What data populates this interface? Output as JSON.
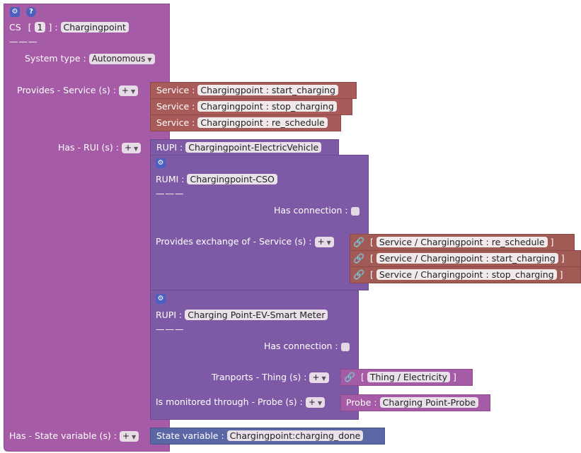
{
  "cs": {
    "prefix": "CS",
    "lb": "[",
    "index": "1",
    "rb": "] :",
    "name": "Chargingpoint",
    "separator": "———",
    "system_type_label": "System type :",
    "system_type_value": "Autonomous",
    "provides_label": "Provides - Service (s) :",
    "has_rui_label": "Has - RUI (s) :",
    "has_state_label": "Has - State variable (s) :",
    "plus": "+"
  },
  "services": [
    {
      "label": "Service :",
      "value": "Chargingpoint : start_charging"
    },
    {
      "label": "Service :",
      "value": "Chargingpoint : stop_charging"
    },
    {
      "label": "Service :",
      "value": "Chargingpoint : re_schedule"
    }
  ],
  "rupi1": {
    "label": "RUPI :",
    "value": "Chargingpoint-ElectricVehicle"
  },
  "rumi": {
    "label": "RUMI :",
    "value": "Chargingpoint-CSO",
    "separator": "———",
    "has_connection_label": "Has connection :",
    "exchange_label": "Provides exchange of - Service (s) :",
    "plus": "+"
  },
  "exchanges": [
    {
      "lb": "[",
      "value": "Service / Chargingpoint : re_schedule",
      "rb": "]"
    },
    {
      "lb": "[",
      "value": "Service / Chargingpoint : start_charging",
      "rb": "]"
    },
    {
      "lb": "[",
      "value": "Service / Chargingpoint : stop_charging",
      "rb": "]"
    }
  ],
  "rupi2": {
    "label": "RUPI :",
    "value": "Charging Point-EV-Smart Meter",
    "separator": "———",
    "has_connection_label": "Has connection :",
    "transports_label": "Tranports - Thing (s) :",
    "monitored_label": "Is monitored through - Probe (s) :",
    "plus": "+"
  },
  "thing": {
    "lb": "[",
    "value": "Thing / Electricity",
    "rb": "]"
  },
  "probe": {
    "label": "Probe :",
    "value": "Charging Point-Probe"
  },
  "state_var": {
    "label": "State variable :",
    "value": "Chargingpoint:charging_done"
  },
  "icons": {
    "gear": "gear-icon",
    "help": "help-icon",
    "link": "link-icon",
    "dropdown": "chevron-down-icon"
  }
}
